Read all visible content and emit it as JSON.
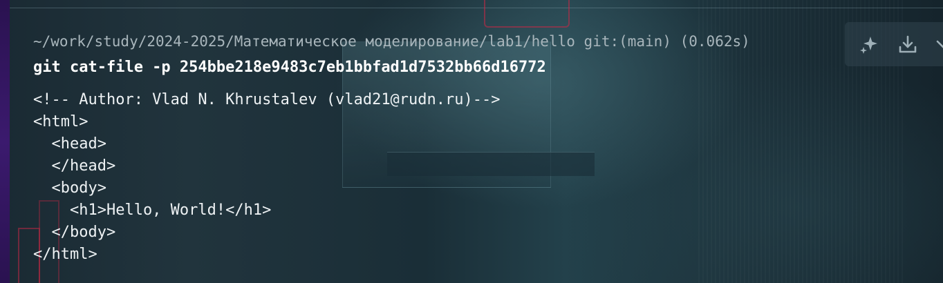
{
  "terminal": {
    "prompt": {
      "path": "~/work/study/2024-2025/Математическое моделирование/lab1/hello",
      "git_branch": "git:(main)",
      "duration": "(0.062s)"
    },
    "command": "git cat-file -p 254bbe218e9483c7eb1bbfad1d7532bb66d16772",
    "output_lines": [
      "<!-- Author: Vlad N. Khrustalev (vlad21@rudn.ru)-->",
      "<html>",
      "  <head>",
      "  </head>",
      "  <body>",
      "    <h1>Hello, World!</h1>",
      "  </body>",
      "</html>"
    ]
  },
  "block_toolbar": {
    "buttons": [
      {
        "icon": "sparkle-icon"
      },
      {
        "icon": "download-icon"
      },
      {
        "icon": "chevron-icon"
      }
    ]
  },
  "colors": {
    "text": "#eef2f4",
    "prompt_text": "#a9b6bc",
    "icon": "#9fb0b8",
    "accent_strip": "#3b1a6e"
  }
}
